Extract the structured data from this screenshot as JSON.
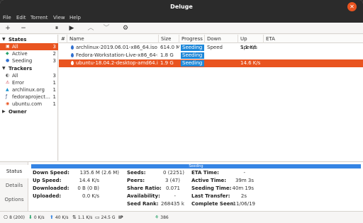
{
  "window": {
    "title": "Deluge",
    "close_symbol": "✕"
  },
  "menu": [
    "File",
    "Edit",
    "Torrent",
    "View",
    "Help"
  ],
  "toolbar": {
    "add_icon": "+",
    "remove_icon": "−",
    "pause_icon": "⏸",
    "resume_icon": "▶",
    "queue_up_icon": "︿",
    "queue_down_icon": "﹀",
    "preferences_icon": "⚙"
  },
  "sidebar": {
    "states": {
      "label": "States",
      "items": [
        {
          "label": "All",
          "count": "3",
          "icon": "all-icon",
          "glyph": "▣"
        },
        {
          "label": "Active",
          "count": "2",
          "icon": "active-icon",
          "glyph": "◆"
        },
        {
          "label": "Seeding",
          "count": "3",
          "icon": "seeding-icon",
          "glyph": "●"
        }
      ]
    },
    "trackers": {
      "label": "Trackers",
      "items": [
        {
          "label": "All",
          "count": "3",
          "icon": "trackers-all-icon",
          "glyph": "◐"
        },
        {
          "label": "Error",
          "count": "1",
          "icon": "error-icon",
          "glyph": "⚠"
        },
        {
          "label": "archlinux.org",
          "count": "1",
          "icon": "archlinux-icon",
          "glyph": "▲"
        },
        {
          "label": "fedoraproject…",
          "count": "1",
          "icon": "fedora-icon",
          "glyph": "ƒ"
        },
        {
          "label": "ubuntu.com",
          "count": "1",
          "icon": "ubuntu-icon",
          "glyph": "◉"
        }
      ]
    },
    "owner": {
      "label": "Owner"
    }
  },
  "list": {
    "columns": [
      "#",
      "Name",
      "Size",
      "Progress",
      "Down Speed",
      "Up Speed",
      "ETA"
    ],
    "rows": [
      {
        "num": "",
        "name": "archlinux-2019.06.01-x86_64.iso",
        "size": "614.0 M",
        "progress": "Seeding",
        "down": "",
        "up": "1.1 K/s",
        "eta": ""
      },
      {
        "num": "",
        "name": "Fedora-Workstation-Live-x86_64-30",
        "size": "1.8 G",
        "progress": "Seeding",
        "down": "",
        "up": "",
        "eta": ""
      },
      {
        "num": "",
        "name": "ubuntu-18.04.2-desktop-amd64.iso",
        "size": "1.9 G",
        "progress": "Seeding",
        "down": "",
        "up": "14.6 K/s",
        "eta": ""
      }
    ]
  },
  "details": {
    "tabs": [
      "Status",
      "Details",
      "Options"
    ],
    "progress_text": "Seeding",
    "progress_fraction": 1.0,
    "col1": [
      {
        "key": "Down Speed:",
        "val": "135.6 M (2.6 M)"
      },
      {
        "key": "Up Speed:",
        "val": "14.4 K/s"
      },
      {
        "key": "Downloaded:",
        "val": "0 B (0 B)"
      },
      {
        "key": "Uploaded:",
        "val": "0.0 K/s"
      }
    ],
    "col2": [
      {
        "key": "Seeds:",
        "val": "0 (2251)"
      },
      {
        "key": "Peers:",
        "val": "3 (47)"
      },
      {
        "key": "Share Ratio:",
        "val": "0.071"
      },
      {
        "key": "Availability:",
        "val": "-"
      },
      {
        "key": "Seed Rank:",
        "val": "268435 k"
      }
    ],
    "col3": [
      {
        "key": "ETA Time:",
        "val": "-"
      },
      {
        "key": "Active Time:",
        "val": "39m 3s"
      },
      {
        "key": "Seeding Time:",
        "val": "40m 19s"
      },
      {
        "key": "Last Transfer:",
        "val": "2s"
      },
      {
        "key": "Complete Seen:",
        "val": "11/06/19"
      }
    ]
  },
  "statusbar": {
    "connections": "8 (200)",
    "down": "0 K/s",
    "up": "40 K/s",
    "protocol": "1.1 K/s",
    "disk": "24.5 G",
    "ip_label": "IP",
    "dht": "386"
  },
  "colors": {
    "accent": "#e95420",
    "seeding": "#1e88d9",
    "titlebar": "#2b2b2b"
  }
}
